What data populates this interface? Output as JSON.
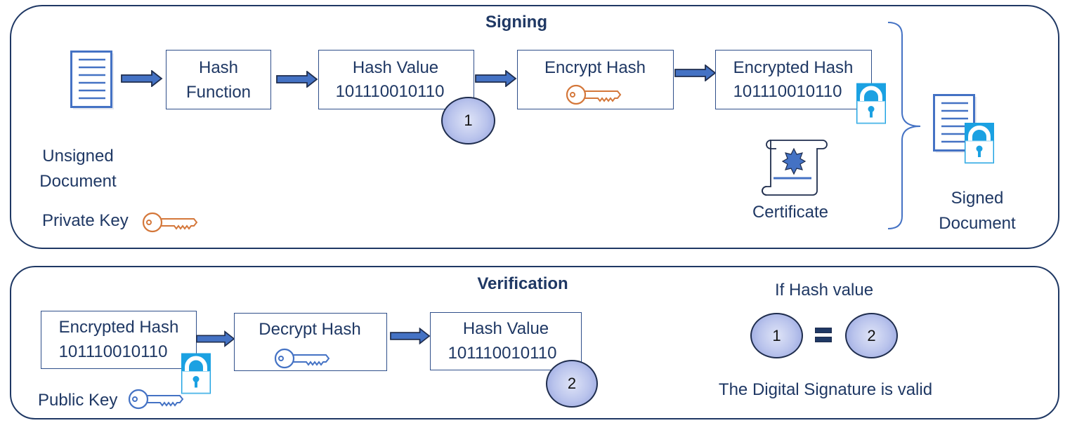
{
  "signing": {
    "title": "Signing",
    "unsigned_document_label": [
      "Unsigned",
      "Document"
    ],
    "private_key_label": "Private Key",
    "hash_function_label": [
      "Hash",
      "Function"
    ],
    "hash_value": {
      "label": "Hash Value",
      "value": "101110010110",
      "marker": "1"
    },
    "encrypt_hash_label": "Encrypt Hash",
    "encrypted_hash": {
      "label": "Encrypted Hash",
      "value": "101110010110"
    },
    "certificate_label": "Certificate",
    "signed_document_label": [
      "Signed",
      "Document"
    ]
  },
  "verification": {
    "title": "Verification",
    "encrypted_hash": {
      "label": "Encrypted Hash",
      "value": "101110010110"
    },
    "public_key_label": "Public Key",
    "decrypt_hash_label": "Decrypt Hash",
    "hash_value": {
      "label": "Hash Value",
      "value": "101110010110",
      "marker": "2"
    },
    "condition_label": "If Hash value",
    "compare_left": "1",
    "compare_right": "2",
    "result_label": "The Digital Signature is valid"
  },
  "colors": {
    "text": "#1f3864",
    "arrow": "#4472c4",
    "private_key": "#d4773a",
    "public_key": "#4472c4",
    "lock": "#1ba1e2",
    "marker_fill": "#b9c3ec"
  },
  "icons": [
    "document-icon",
    "arrow-right-icon",
    "key-icon",
    "lock-icon",
    "certificate-icon",
    "brace-icon",
    "signed-document-icon",
    "equals-icon"
  ]
}
